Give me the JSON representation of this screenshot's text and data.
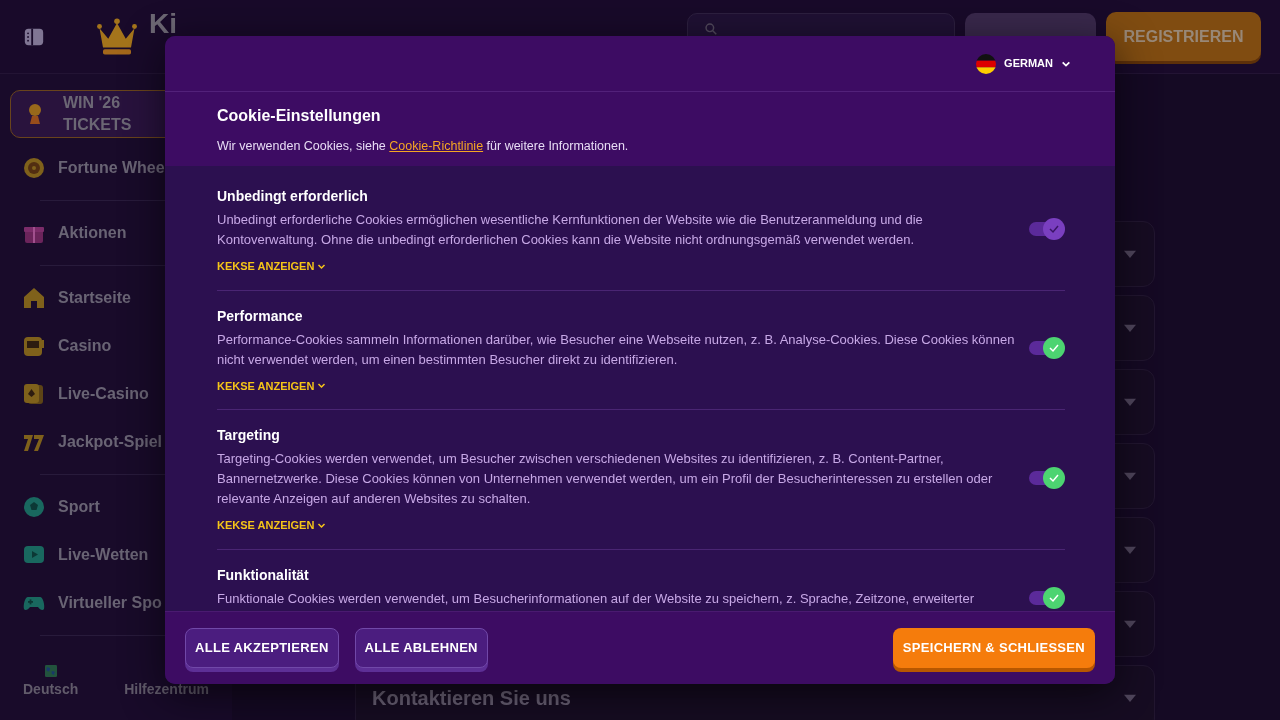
{
  "header": {
    "logo": "Ki",
    "buttons": [
      {
        "kind": "login"
      },
      {
        "kind": "register",
        "label": "REGISTRIEREN"
      }
    ]
  },
  "sidebar": {
    "promo": "WIN '26 TICKETS",
    "groups": [
      [
        {
          "label": "Fortune Whee"
        }
      ],
      [
        {
          "label": "Aktionen"
        }
      ],
      [
        {
          "label": "Startseite"
        },
        {
          "label": "Casino"
        },
        {
          "label": "Live-Casino"
        },
        {
          "label": "Jackpot-Spiel"
        }
      ],
      [
        {
          "label": "Sport"
        },
        {
          "label": "Live-Wetten"
        },
        {
          "label": "Virtueller Spo"
        }
      ]
    ],
    "footer": [
      {
        "label": "Deutsch"
      },
      {
        "label": "Hilfezentrum"
      }
    ]
  },
  "faq": [
    {
      "kind": "covered"
    },
    {
      "kind": "covered"
    },
    {
      "kind": "covered"
    },
    {
      "kind": "covered"
    },
    {
      "kind": "covered"
    },
    {
      "kind": "covered"
    },
    {
      "kind": "titled",
      "title": "Kontaktieren Sie uns"
    }
  ],
  "cookie_dialog": {
    "language": "GERMAN",
    "title": "Cookie-Einstellungen",
    "intro": {
      "before": "Wir verwenden Cookies, siehe ",
      "link": "Cookie-Richtlinie",
      "after": " für weitere Informationen."
    },
    "categories": [
      {
        "title": "Unbedingt erforderlich",
        "description": "Unbedingt erforderliche Cookies ermöglichen wesentliche Kernfunktionen der Website wie die Benutzeranmeldung und die Kontoverwaltung. Ohne die unbedingt erforderlichen Cookies kann die Website nicht ordnungsgemäß verwendet werden.",
        "details": "KEKSE ANZEIGEN",
        "checked": true,
        "disabled": true
      },
      {
        "title": "Performance",
        "description": "Performance-Cookies sammeln Informationen darüber, wie Besucher eine Webseite nutzen, z. B. Analyse-Cookies. Diese Cookies können nicht verwendet werden, um einen bestimmten Besucher direkt zu identifizieren.",
        "details": "KEKSE ANZEIGEN",
        "checked": true,
        "disabled": false
      },
      {
        "title": "Targeting",
        "description": "Targeting-Cookies werden verwendet, um Besucher zwischen verschiedenen Websites zu identifizieren, z. B. Content-Partner, Bannernetzwerke. Diese Cookies können von Unternehmen verwendet werden, um ein Profil der Besucherinteressen zu erstellen oder relevante Anzeigen auf anderen Websites zu schalten.",
        "details": "KEKSE ANZEIGEN",
        "checked": true,
        "disabled": false
      },
      {
        "title": "Funktionalität",
        "description": "Funktionale Cookies werden verwendet, um Besucherinformationen auf der Website zu speichern, z. Sprache, Zeitzone, erweiterter",
        "checked": true,
        "disabled": false
      }
    ],
    "buttons": [
      {
        "kind": "secondary",
        "label": "ALLE AKZEPTIEREN"
      },
      {
        "kind": "secondary",
        "label": "ALLE ABLEHNEN"
      },
      {
        "kind": "primary",
        "label": "SPEICHERN & SCHLIESSEN"
      }
    ]
  }
}
